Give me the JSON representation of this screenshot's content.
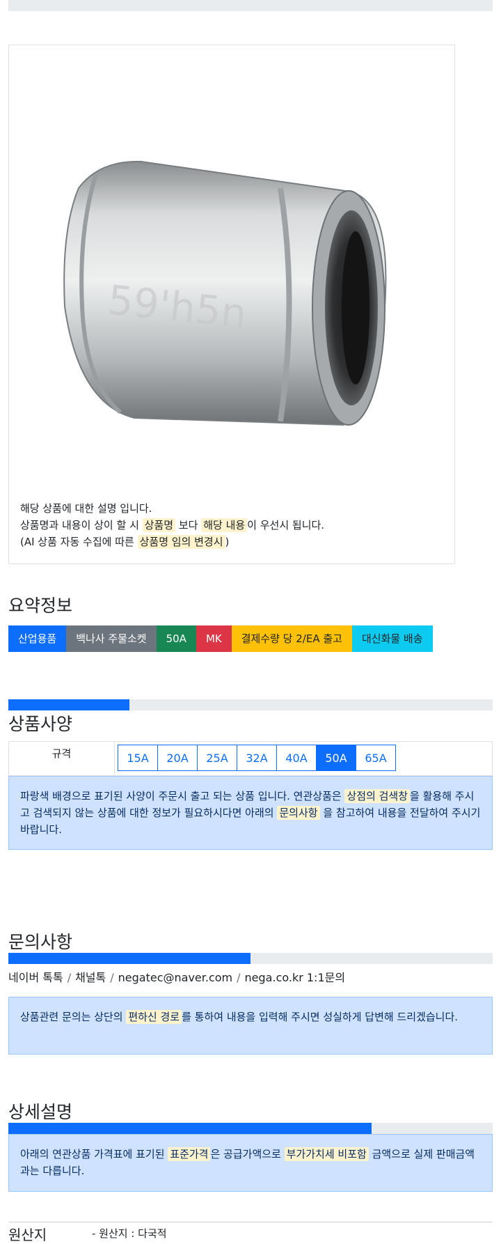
{
  "product": {
    "notes": {
      "line1": "해당 상품에 대한 설명 입니다.",
      "line2_a": "상품명과 내용이 상이 할 시 ",
      "line2_hl1": "상품명",
      "line2_b": " 보다 ",
      "line2_hl2": "해당 내용",
      "line2_c": "이 우선시 됩니다.",
      "line3_a": "(AI 상품 자동 수집에 따른 ",
      "line3_hl": "상품명 임의 변경시",
      "line3_b": ")"
    }
  },
  "summary": {
    "title": "요약정보",
    "badges": [
      "산업용품",
      "백나사 주물소켓",
      "50A",
      "MK",
      "결제수량 당 2/EA 출고",
      "대신화물 배송"
    ]
  },
  "spec": {
    "title": "상품사양",
    "label": "규격",
    "options": [
      "15A",
      "20A",
      "25A",
      "32A",
      "40A",
      "50A",
      "65A"
    ],
    "selected": "50A",
    "progress": 0.25,
    "info_a": "파랑색 배경으로 표기된 사양이 주문시 출고 되는 상품 입니다. 연관상품은 ",
    "info_hl1": "상점의 검색창",
    "info_b": "을 활용해 주시고 검색되지 않는 상품에 대한 정보가 필요하시다면 아래의 ",
    "info_hl2": "문의사항",
    "info_c": " 을 참고하여 내용을 전달하여 주시기 바랍니다."
  },
  "inquiry": {
    "title": "문의사항",
    "progress": 0.5,
    "contacts": [
      "네이버 톡톡",
      "채널톡",
      "negatec@naver.com",
      "nega.co.kr 1:1문의"
    ],
    "separator": "/",
    "info_a": "상품관련 문의는 상단의 ",
    "info_hl": "편하신 경로",
    "info_b": "를 통하여 내용을 입력해 주시면 성실하게 답변해 드리겠습니다."
  },
  "detail": {
    "title": "상세설명",
    "progress": 0.75,
    "info_a": "아래의 연관상품 가격표에 표기된 ",
    "info_hl1": "표준가격",
    "info_b": "은 공급가액으로 ",
    "info_hl2": "부가가치세 비포함",
    "info_c": " 금액으로 실제 판매금액과는 다릅니다."
  },
  "origin": {
    "label": "원산지",
    "value": "- 원산지 : 다국적"
  },
  "colors": {
    "primary": "#0d6efd",
    "secondary": "#6c757d",
    "success": "#198754",
    "danger": "#dc3545",
    "warning": "#ffc107",
    "info": "#0dcaf0",
    "alert_bg": "#cfe2ff",
    "highlight": "#fff3cd"
  }
}
